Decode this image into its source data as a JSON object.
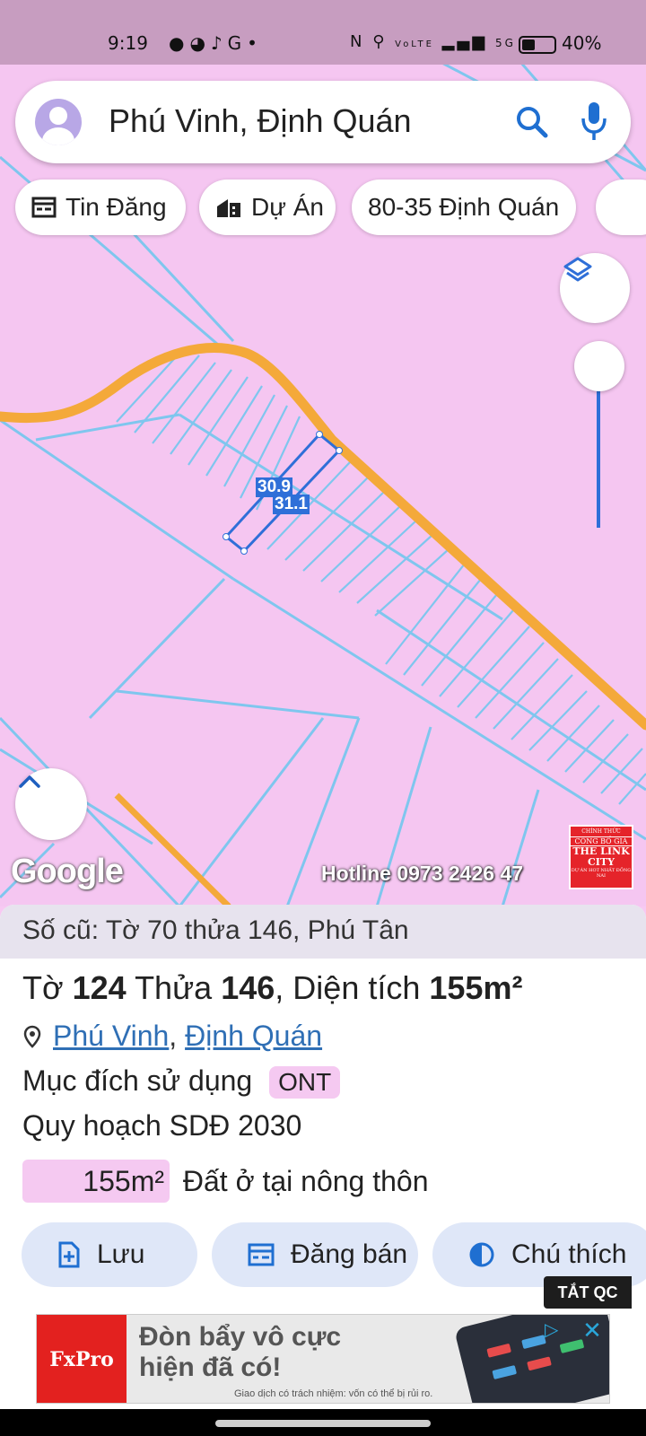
{
  "status_bar": {
    "time": "9:19",
    "left_icons": [
      "app-icon",
      "app-icon",
      "tiktok-icon",
      "google-icon",
      "dot-icon"
    ],
    "right_icons": [
      "nfc-icon",
      "location-icon",
      "volte-icon",
      "signal-icon",
      "5g-icon",
      "battery-icon"
    ],
    "battery": "40%",
    "volte_text": "VoLTE",
    "network_text": "5G"
  },
  "search": {
    "query": "Phú Vinh, Định Quán",
    "search_icon": "search-icon",
    "mic_icon": "mic-icon"
  },
  "chips": [
    {
      "label": "Tin Đăng",
      "icon": "listing-icon"
    },
    {
      "label": "Dự Án",
      "icon": "building-icon"
    },
    {
      "label": "80-35 Định Quán",
      "icon": ""
    }
  ],
  "map": {
    "parcel_labels": [
      "30.9",
      "31.1"
    ],
    "attribution": "Google",
    "hotline": "Hotline 0973 2426 47",
    "badge_lines": [
      "CHÍNH THỨC",
      "CÔNG BỐ GIÁ",
      "THE LINK CITY",
      "DỰ ÁN HOT NHẤT ĐỒNG NAI"
    ],
    "colors": {
      "land": "#f5c6f1",
      "parcel_lines": "#7fc6ee",
      "road": "#f4a93a",
      "selection": "#2f6fd8"
    }
  },
  "info": {
    "old_number": "Số cũ: Tờ 70 thửa 146, Phú Tân",
    "to_label": "Tờ",
    "to_value": "124",
    "thua_label": "Thửa",
    "thua_value": "146",
    "area_label": ", Diện tích",
    "area_value": "155m²",
    "location_commune": "Phú Vinh",
    "location_district": "Định Quán",
    "purpose_label": "Mục đích sử dụng",
    "purpose_tag": "ONT",
    "plan_title": "Quy hoạch SDĐ 2030",
    "plan_area": "155m²",
    "plan_desc": "Đất ở tại nông thôn"
  },
  "actions": [
    {
      "label": "Lưu",
      "icon": "bookmark-add-icon"
    },
    {
      "label": "Đăng bán",
      "icon": "listing-icon"
    },
    {
      "label": "Chú thích",
      "icon": "legend-icon"
    }
  ],
  "ad": {
    "close_label": "TẮT QC",
    "brand": "FxPro",
    "headline_line1": "Đòn bẩy vô cực",
    "headline_line2": "hiện đã có!",
    "disclaimer": "Giao dịch có trách nhiệm: vốn có thể bị rủi ro."
  }
}
